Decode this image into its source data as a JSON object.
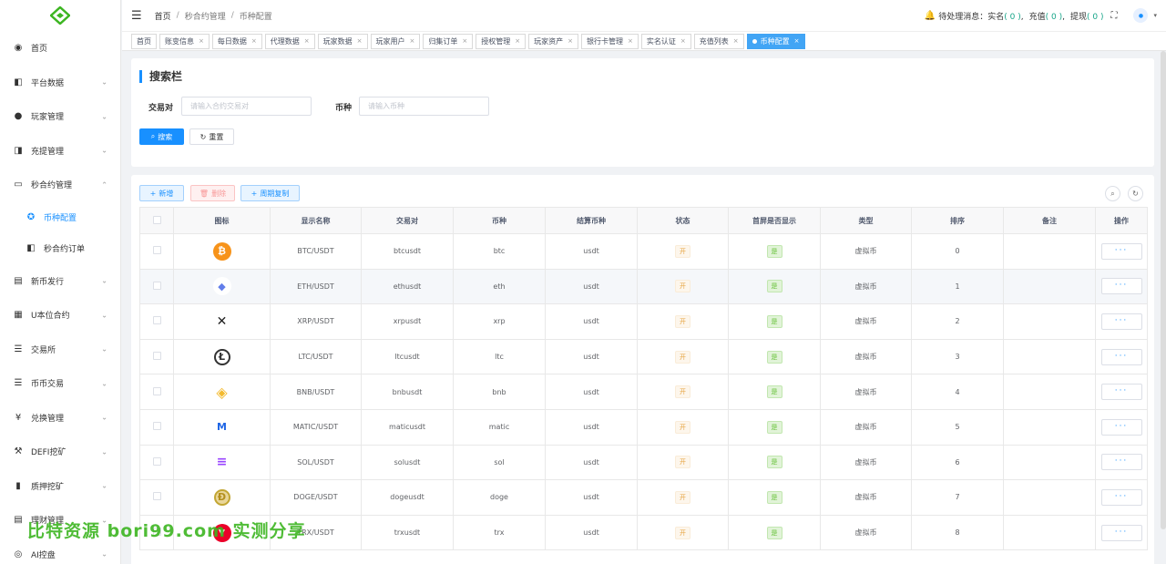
{
  "colors": {
    "primary": "#1890ff",
    "accent_green": "#17a589",
    "active_tab": "#42a5f5",
    "logo_green": "#3cb521"
  },
  "sidebar": {
    "items": [
      {
        "label": "首页",
        "icon": "dashboard-icon",
        "glyph": "◉",
        "arrow": ""
      },
      {
        "label": "平台数据",
        "icon": "data-icon",
        "glyph": "◧",
        "arrow": "⌄"
      },
      {
        "label": "玩家管理",
        "icon": "user-icon",
        "glyph": "●",
        "arrow": "⌄"
      },
      {
        "label": "充提管理",
        "icon": "wallet-icon",
        "glyph": "◨",
        "arrow": "⌄"
      },
      {
        "label": "秒合约管理",
        "icon": "monitor-icon",
        "glyph": "▭",
        "arrow": "⌃"
      },
      {
        "label": "币种配置",
        "icon": "gear-icon",
        "glyph": "✪",
        "arrow": "",
        "sub": true,
        "active": true
      },
      {
        "label": "秒合约订单",
        "icon": "order-icon",
        "glyph": "◧",
        "arrow": "",
        "sub": true
      },
      {
        "label": "新币发行",
        "icon": "release-icon",
        "glyph": "▤",
        "arrow": "⌄"
      },
      {
        "label": "U本位合约",
        "icon": "grid-icon",
        "glyph": "▦",
        "arrow": "⌄"
      },
      {
        "label": "交易所",
        "icon": "list-icon",
        "glyph": "☰",
        "arrow": "⌄"
      },
      {
        "label": "币币交易",
        "icon": "menu-icon",
        "glyph": "☰",
        "arrow": "⌄"
      },
      {
        "label": "兑换管理",
        "icon": "yen-icon",
        "glyph": "¥",
        "arrow": "⌄"
      },
      {
        "label": "DEFI挖矿",
        "icon": "mining-icon",
        "glyph": "⚒",
        "arrow": "⌄"
      },
      {
        "label": "质押挖矿",
        "icon": "chart-icon",
        "glyph": "▮",
        "arrow": "⌄"
      },
      {
        "label": "理财管理",
        "icon": "document-icon",
        "glyph": "▤",
        "arrow": "⌄"
      },
      {
        "label": "AI控盘",
        "icon": "robot-icon",
        "glyph": "◎",
        "arrow": "⌄"
      }
    ]
  },
  "header": {
    "breadcrumb": [
      "首页",
      "秒合约管理",
      "币种配置"
    ],
    "pending_label": "待处理消息：",
    "realname_label": "实名",
    "realname_count": "( 0 )",
    "deposit_label": "充值",
    "deposit_count": "( 0 )",
    "withdraw_label": "提现",
    "withdraw_count": "( 0 )"
  },
  "tabs": [
    "首页",
    "账变信息",
    "每日数据",
    "代理数据",
    "玩家数据",
    "玩家用户",
    "归集订单",
    "授权管理",
    "玩家资产",
    "银行卡管理",
    "实名认证",
    "充值列表",
    "币种配置"
  ],
  "search": {
    "title": "搜索栏",
    "pair_label": "交易对",
    "pair_placeholder": "请输入合约交易对",
    "coin_label": "币种",
    "coin_placeholder": "请输入币种",
    "search_btn": "搜索",
    "reset_btn": "重置"
  },
  "toolbar": {
    "add": "新增",
    "delete": "删除",
    "copy": "周期复制"
  },
  "table": {
    "columns": [
      "图标",
      "显示名称",
      "交易对",
      "币种",
      "结算币种",
      "状态",
      "首屏是否显示",
      "类型",
      "排序",
      "备注",
      "操作"
    ],
    "rows": [
      {
        "icon": "btc-icon",
        "glyph": "₿",
        "color": "#f7931a",
        "name": "BTC/USDT",
        "pair": "btcusdt",
        "coin": "btc",
        "settle": "usdt",
        "status": "开",
        "home": "是",
        "type": "虚拟币",
        "sort": "0",
        "note": ""
      },
      {
        "icon": "eth-icon",
        "glyph": "◆",
        "color": "#ffffff",
        "name": "ETH/USDT",
        "pair": "ethusdt",
        "coin": "eth",
        "settle": "usdt",
        "status": "开",
        "home": "是",
        "type": "虚拟币",
        "sort": "1",
        "note": ""
      },
      {
        "icon": "xrp-icon",
        "glyph": "✕",
        "color": "#ffffff",
        "name": "XRP/USDT",
        "pair": "xrpusdt",
        "coin": "xrp",
        "settle": "usdt",
        "status": "开",
        "home": "是",
        "type": "虚拟币",
        "sort": "2",
        "note": ""
      },
      {
        "icon": "ltc-icon",
        "glyph": "Ł",
        "color": "#ffffff",
        "name": "LTC/USDT",
        "pair": "ltcusdt",
        "coin": "ltc",
        "settle": "usdt",
        "status": "开",
        "home": "是",
        "type": "虚拟币",
        "sort": "3",
        "note": ""
      },
      {
        "icon": "bnb-icon",
        "glyph": "◈",
        "color": "#ffffff",
        "name": "BNB/USDT",
        "pair": "bnbusdt",
        "coin": "bnb",
        "settle": "usdt",
        "status": "开",
        "home": "是",
        "type": "虚拟币",
        "sort": "4",
        "note": ""
      },
      {
        "icon": "matic-icon",
        "glyph": "M",
        "color": "#ffffff",
        "name": "MATIC/USDT",
        "pair": "maticusdt",
        "coin": "matic",
        "settle": "usdt",
        "status": "开",
        "home": "是",
        "type": "虚拟币",
        "sort": "5",
        "note": ""
      },
      {
        "icon": "sol-icon",
        "glyph": "≡",
        "color": "#ffffff",
        "name": "SOL/USDT",
        "pair": "solusdt",
        "coin": "sol",
        "settle": "usdt",
        "status": "开",
        "home": "是",
        "type": "虚拟币",
        "sort": "6",
        "note": ""
      },
      {
        "icon": "doge-icon",
        "glyph": "Ð",
        "color": "#c2a633",
        "name": "DOGE/USDT",
        "pair": "dogeusdt",
        "coin": "doge",
        "settle": "usdt",
        "status": "开",
        "home": "是",
        "type": "虚拟币",
        "sort": "7",
        "note": ""
      },
      {
        "icon": "trx-icon",
        "glyph": "▼",
        "color": "#eb0029",
        "name": "TRX/USDT",
        "pair": "trxusdt",
        "coin": "trx",
        "settle": "usdt",
        "status": "开",
        "home": "是",
        "type": "虚拟币",
        "sort": "8",
        "note": ""
      }
    ],
    "more": "···"
  },
  "watermark": "比特资源 bori99.com 实测分享"
}
